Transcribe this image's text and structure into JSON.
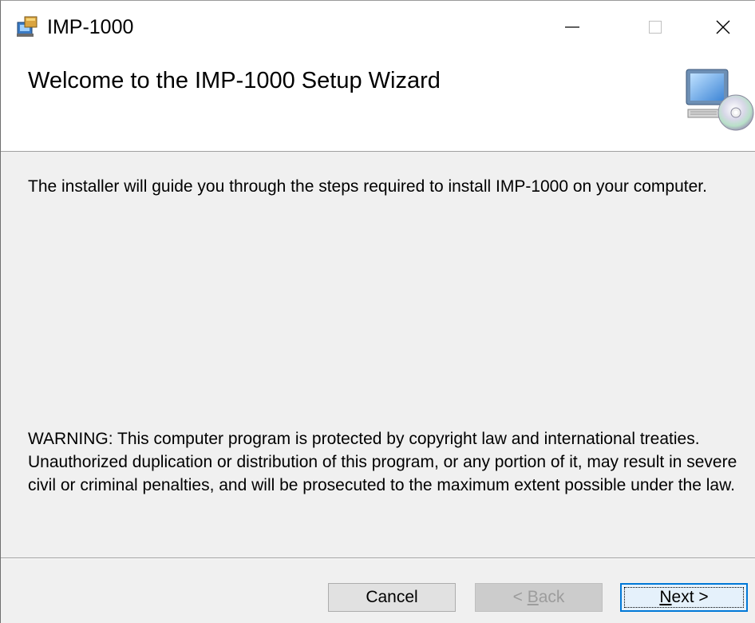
{
  "window": {
    "title": "IMP-1000",
    "controls": {
      "minimize": "—",
      "maximize": "☐",
      "close": "✕"
    }
  },
  "banner": {
    "title": "Welcome to the IMP-1000 Setup Wizard",
    "icon": "computer-cd-icon"
  },
  "body": {
    "intro": "The installer will guide you through the steps required to install IMP-1000 on your computer.",
    "warning": "WARNING: This computer program is protected by copyright law and international treaties. Unauthorized duplication or distribution of this program, or any portion of it, may result in severe civil or criminal penalties, and will be prosecuted to the maximum extent possible under the law."
  },
  "buttons": {
    "cancel": "Cancel",
    "back_prefix": "< ",
    "back_accel": "B",
    "back_rest": "ack",
    "next_accel": "N",
    "next_rest": "ext >"
  },
  "colors": {
    "accent": "#0078d7",
    "background": "#f0f0f0"
  }
}
